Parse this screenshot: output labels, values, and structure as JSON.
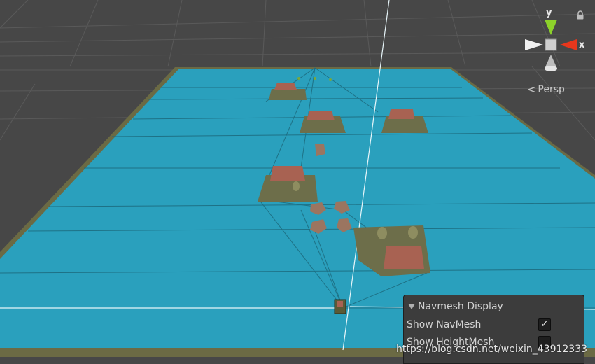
{
  "gizmo": {
    "axis_y": "y",
    "axis_x": "x",
    "projection_label": "Persp",
    "colors": {
      "y": "#8cd12a",
      "x": "#e8371c",
      "z": "#ffffff"
    }
  },
  "icons": {
    "lock": "lock-icon",
    "chevron": "chevron-left-icon",
    "foldout": "triangle-down-icon",
    "check": "checkmark-icon"
  },
  "navmesh_display": {
    "title": "Navmesh Display",
    "show_navmesh_label": "Show NavMesh",
    "show_navmesh_checked": "✓",
    "show_heightmesh_label": "Show HeightMesh",
    "show_heightmesh_checked": ""
  },
  "watermark": "https://blog.csdn.net/weixin_43912333",
  "colors": {
    "background": "#474747",
    "grid": "#5a5a5a",
    "navmesh": "#2aa0bd",
    "ground_edge": "#6b6a44",
    "island": "#6d6e4a",
    "roof": "#a86252"
  }
}
